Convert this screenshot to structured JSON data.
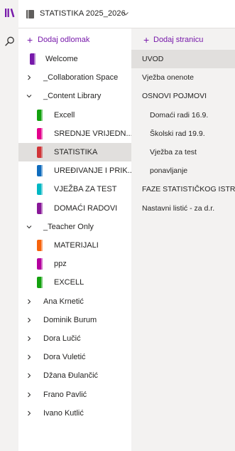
{
  "notebook": {
    "title": "STATISTIKA 2025_2026"
  },
  "sections_pane": {
    "add_label": "Dodaj odlomak",
    "items": [
      {
        "label": "Welcome",
        "type": "section",
        "color": "#7719aa",
        "indent": 0,
        "expand": ""
      },
      {
        "label": "_Collaboration Space",
        "type": "group",
        "color": "",
        "indent": 0,
        "expand": "collapsed"
      },
      {
        "label": "_Content Library",
        "type": "group",
        "color": "",
        "indent": 0,
        "expand": "expanded"
      },
      {
        "label": "Excell",
        "type": "section",
        "color": "#13a10e",
        "indent": 1,
        "expand": ""
      },
      {
        "label": "SREDNJE VRIJEDN...",
        "type": "section",
        "color": "#e3008c",
        "indent": 1,
        "expand": ""
      },
      {
        "label": "STATISTIKA",
        "type": "section",
        "color": "#d13438",
        "indent": 1,
        "expand": "",
        "selected": true
      },
      {
        "label": "UREĐIVANJE I PRIK...",
        "type": "section",
        "color": "#0f6cbd",
        "indent": 1,
        "expand": ""
      },
      {
        "label": "VJEŽBA ZA TEST",
        "type": "section",
        "color": "#00b7c3",
        "indent": 1,
        "expand": ""
      },
      {
        "label": "DOMAĆI RADOVI",
        "type": "section",
        "color": "#881798",
        "indent": 1,
        "expand": ""
      },
      {
        "label": "_Teacher Only",
        "type": "group",
        "color": "",
        "indent": 0,
        "expand": "expanded"
      },
      {
        "label": "MATERIJALI",
        "type": "section",
        "color": "#f7630c",
        "indent": 1,
        "expand": ""
      },
      {
        "label": "ppz",
        "type": "section",
        "color": "#b4009e",
        "indent": 1,
        "expand": ""
      },
      {
        "label": "EXCELL",
        "type": "section",
        "color": "#13a10e",
        "indent": 1,
        "expand": ""
      },
      {
        "label": "Ana Krnetić",
        "type": "group",
        "color": "",
        "indent": 0,
        "expand": "collapsed"
      },
      {
        "label": "Dominik Burum",
        "type": "group",
        "color": "",
        "indent": 0,
        "expand": "collapsed"
      },
      {
        "label": "Dora Lučić",
        "type": "group",
        "color": "",
        "indent": 0,
        "expand": "collapsed"
      },
      {
        "label": "Dora Vuletić",
        "type": "group",
        "color": "",
        "indent": 0,
        "expand": "collapsed"
      },
      {
        "label": "Džana Đulančić",
        "type": "group",
        "color": "",
        "indent": 0,
        "expand": "collapsed"
      },
      {
        "label": "Frano Pavlić",
        "type": "group",
        "color": "",
        "indent": 0,
        "expand": "collapsed"
      },
      {
        "label": "Ivano Kutlić",
        "type": "group",
        "color": "",
        "indent": 0,
        "expand": "collapsed"
      }
    ]
  },
  "pages_pane": {
    "add_label": "Dodaj stranicu",
    "items": [
      {
        "label": "UVOD",
        "level": 0,
        "selected": true
      },
      {
        "label": "Vježba onenote",
        "level": 0
      },
      {
        "label": "OSNOVI POJMOVI",
        "level": 0
      },
      {
        "label": "Domaći radi 16.9.",
        "level": 1
      },
      {
        "label": "Školski rad 19.9.",
        "level": 1
      },
      {
        "label": "Vježba za test",
        "level": 1
      },
      {
        "label": "ponavljanje",
        "level": 1
      },
      {
        "label": "FAZE STATISTIČKOG ISTR...",
        "level": 0
      },
      {
        "label": "Nastavni listić - za d.r.",
        "level": 0
      }
    ]
  },
  "colors": {
    "accent": "#7719aa",
    "selected_bg": "#e1dfdd",
    "pages_bg": "#f3f2f1"
  }
}
